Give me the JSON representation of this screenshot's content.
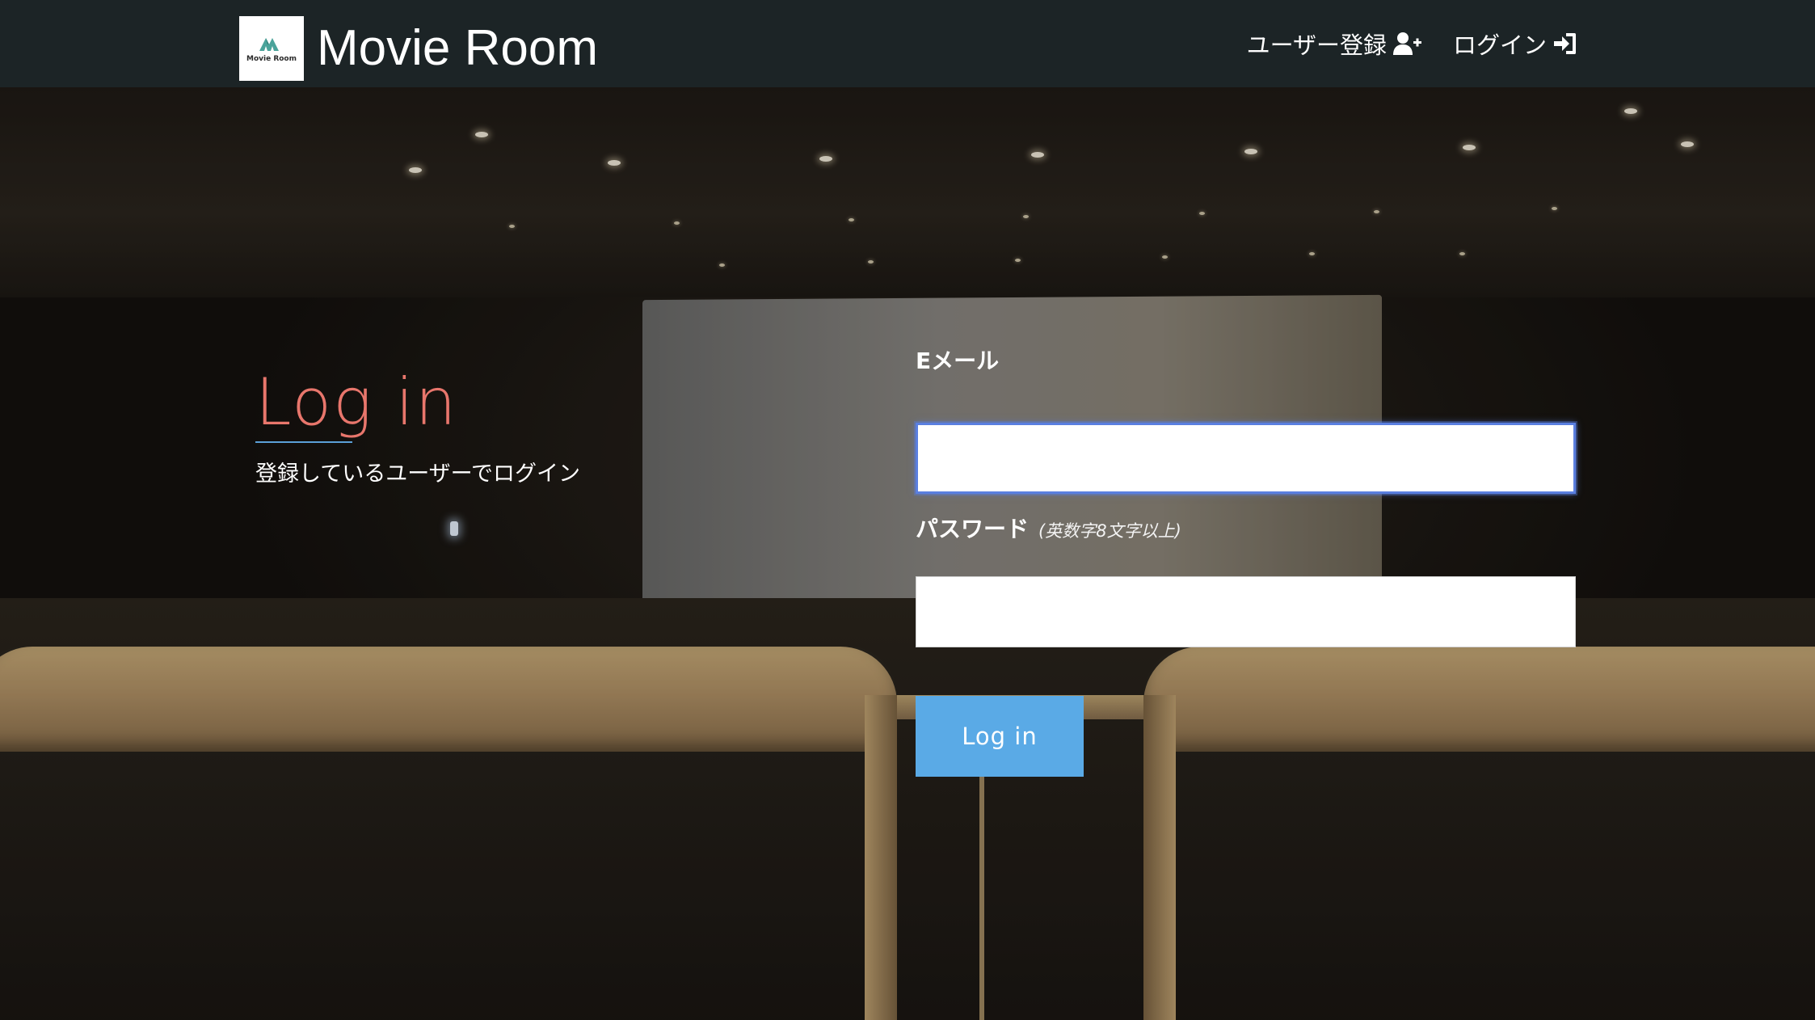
{
  "navbar": {
    "logo_text": "Movie Room",
    "brand_name": "Movie Room",
    "links": [
      {
        "label": "ユーザー登録",
        "icon": "user-plus-icon"
      },
      {
        "label": "ログイン",
        "icon": "sign-in-icon"
      }
    ]
  },
  "hero": {
    "title": "Log in",
    "subtitle": "登録しているユーザーでログイン"
  },
  "form": {
    "email_label": "Eメール",
    "email_value": "",
    "password_label": "パスワード",
    "password_hint": "(英数字8文字以上)",
    "password_value": "",
    "submit_label": "Log in"
  },
  "colors": {
    "navbar_bg": "#1c2426",
    "title_accent": "#e8766c",
    "underline_accent": "#5ba0d8",
    "button_bg": "#5aaae6",
    "focus_border": "#5a7fe0"
  }
}
